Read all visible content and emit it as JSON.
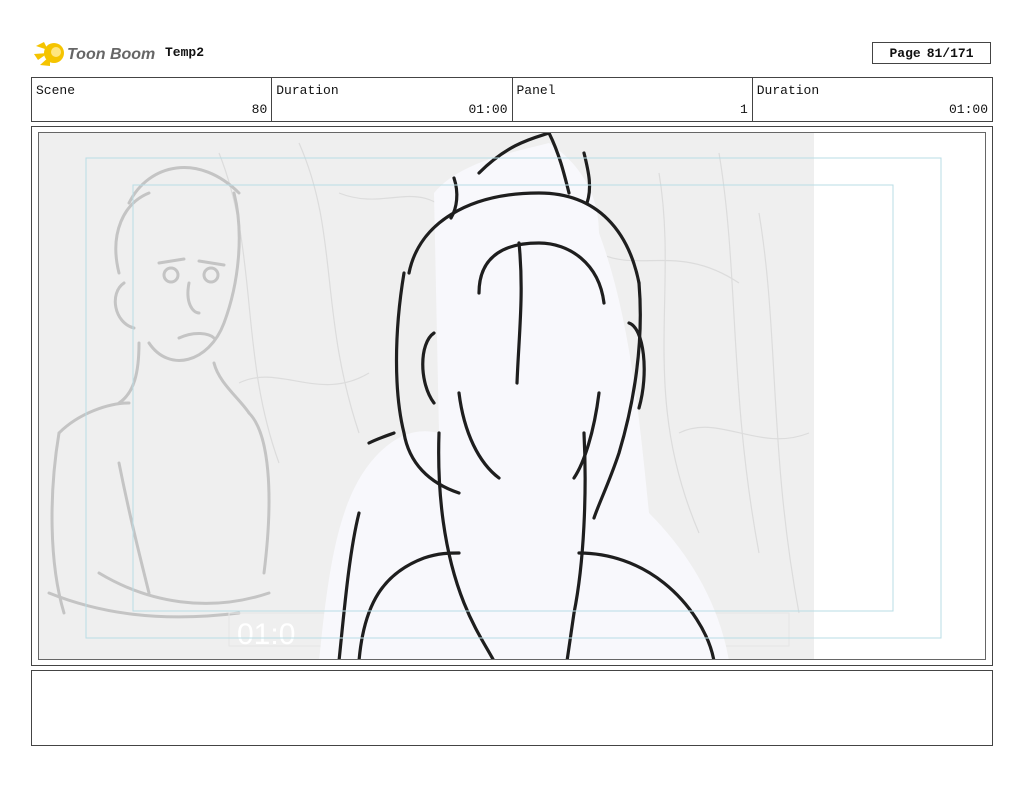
{
  "header": {
    "logo_text": "Toon Boom",
    "project_title": "Temp2",
    "page_label": "Page",
    "page_value": "81/171"
  },
  "info": [
    {
      "label": "Scene",
      "value": "80"
    },
    {
      "label": "Duration",
      "value": "01:00"
    },
    {
      "label": "Panel",
      "value": "1"
    },
    {
      "label": "Duration",
      "value": "01:00"
    }
  ],
  "panel": {
    "timecode_overlay": "01:0"
  },
  "notes": {
    "text": ""
  },
  "colors": {
    "logo_yellow": "#f5c400",
    "guide_cyan": "#b8dde6",
    "sketch_gray": "#c4c4c4"
  }
}
